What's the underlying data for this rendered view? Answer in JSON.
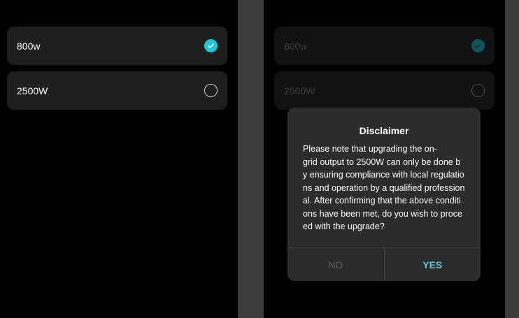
{
  "left_screen": {
    "options": [
      {
        "label": "800w",
        "selected": true
      },
      {
        "label": "2500W",
        "selected": false
      }
    ]
  },
  "right_screen": {
    "options": [
      {
        "label": "800w",
        "selected": true
      },
      {
        "label": "2500W",
        "selected": false
      }
    ],
    "dialog": {
      "title": "Disclaimer",
      "lines": [
        "Please note that upgrading the on-",
        "grid output to 2500W can only be done b",
        "y ensuring compliance with local regulatio",
        "ns and operation by a qualified profession",
        "al. After confirming that the above conditi",
        "ons have been met, do you wish to proce",
        "ed with the upgrade?"
      ],
      "no_label": "NO",
      "yes_label": "YES"
    }
  },
  "colors": {
    "accent": "#1ec5d8",
    "yes_text": "#5ec8d8",
    "card_bg": "#1e1e1e",
    "dialog_bg": "#2b2c2e"
  },
  "icons": {
    "selected": "check-circle-icon",
    "unselected": "radio-empty-icon"
  }
}
